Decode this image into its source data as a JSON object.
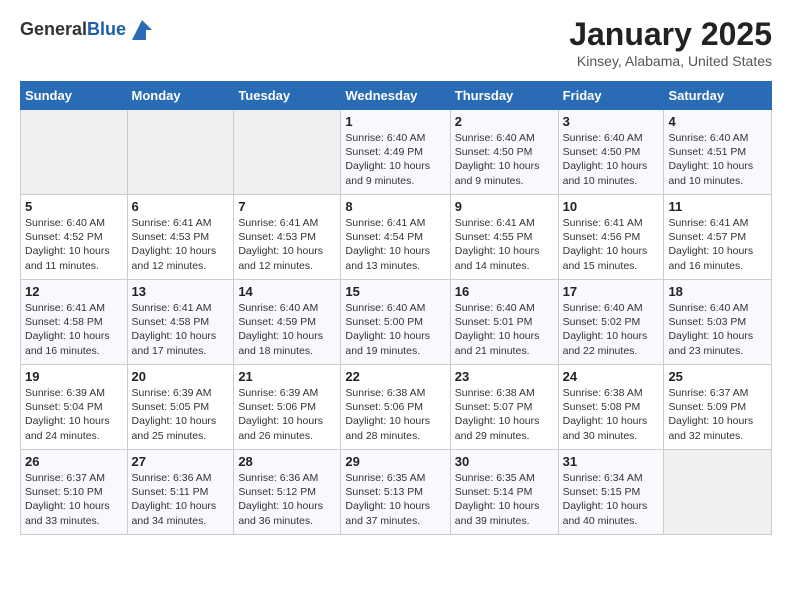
{
  "header": {
    "logo_general": "General",
    "logo_blue": "Blue",
    "month": "January 2025",
    "location": "Kinsey, Alabama, United States"
  },
  "days_of_week": [
    "Sunday",
    "Monday",
    "Tuesday",
    "Wednesday",
    "Thursday",
    "Friday",
    "Saturday"
  ],
  "weeks": [
    [
      {
        "num": "",
        "info": ""
      },
      {
        "num": "",
        "info": ""
      },
      {
        "num": "",
        "info": ""
      },
      {
        "num": "1",
        "info": "Sunrise: 6:40 AM\nSunset: 4:49 PM\nDaylight: 10 hours\nand 9 minutes."
      },
      {
        "num": "2",
        "info": "Sunrise: 6:40 AM\nSunset: 4:50 PM\nDaylight: 10 hours\nand 9 minutes."
      },
      {
        "num": "3",
        "info": "Sunrise: 6:40 AM\nSunset: 4:50 PM\nDaylight: 10 hours\nand 10 minutes."
      },
      {
        "num": "4",
        "info": "Sunrise: 6:40 AM\nSunset: 4:51 PM\nDaylight: 10 hours\nand 10 minutes."
      }
    ],
    [
      {
        "num": "5",
        "info": "Sunrise: 6:40 AM\nSunset: 4:52 PM\nDaylight: 10 hours\nand 11 minutes."
      },
      {
        "num": "6",
        "info": "Sunrise: 6:41 AM\nSunset: 4:53 PM\nDaylight: 10 hours\nand 12 minutes."
      },
      {
        "num": "7",
        "info": "Sunrise: 6:41 AM\nSunset: 4:53 PM\nDaylight: 10 hours\nand 12 minutes."
      },
      {
        "num": "8",
        "info": "Sunrise: 6:41 AM\nSunset: 4:54 PM\nDaylight: 10 hours\nand 13 minutes."
      },
      {
        "num": "9",
        "info": "Sunrise: 6:41 AM\nSunset: 4:55 PM\nDaylight: 10 hours\nand 14 minutes."
      },
      {
        "num": "10",
        "info": "Sunrise: 6:41 AM\nSunset: 4:56 PM\nDaylight: 10 hours\nand 15 minutes."
      },
      {
        "num": "11",
        "info": "Sunrise: 6:41 AM\nSunset: 4:57 PM\nDaylight: 10 hours\nand 16 minutes."
      }
    ],
    [
      {
        "num": "12",
        "info": "Sunrise: 6:41 AM\nSunset: 4:58 PM\nDaylight: 10 hours\nand 16 minutes."
      },
      {
        "num": "13",
        "info": "Sunrise: 6:41 AM\nSunset: 4:58 PM\nDaylight: 10 hours\nand 17 minutes."
      },
      {
        "num": "14",
        "info": "Sunrise: 6:40 AM\nSunset: 4:59 PM\nDaylight: 10 hours\nand 18 minutes."
      },
      {
        "num": "15",
        "info": "Sunrise: 6:40 AM\nSunset: 5:00 PM\nDaylight: 10 hours\nand 19 minutes."
      },
      {
        "num": "16",
        "info": "Sunrise: 6:40 AM\nSunset: 5:01 PM\nDaylight: 10 hours\nand 21 minutes."
      },
      {
        "num": "17",
        "info": "Sunrise: 6:40 AM\nSunset: 5:02 PM\nDaylight: 10 hours\nand 22 minutes."
      },
      {
        "num": "18",
        "info": "Sunrise: 6:40 AM\nSunset: 5:03 PM\nDaylight: 10 hours\nand 23 minutes."
      }
    ],
    [
      {
        "num": "19",
        "info": "Sunrise: 6:39 AM\nSunset: 5:04 PM\nDaylight: 10 hours\nand 24 minutes."
      },
      {
        "num": "20",
        "info": "Sunrise: 6:39 AM\nSunset: 5:05 PM\nDaylight: 10 hours\nand 25 minutes."
      },
      {
        "num": "21",
        "info": "Sunrise: 6:39 AM\nSunset: 5:06 PM\nDaylight: 10 hours\nand 26 minutes."
      },
      {
        "num": "22",
        "info": "Sunrise: 6:38 AM\nSunset: 5:06 PM\nDaylight: 10 hours\nand 28 minutes."
      },
      {
        "num": "23",
        "info": "Sunrise: 6:38 AM\nSunset: 5:07 PM\nDaylight: 10 hours\nand 29 minutes."
      },
      {
        "num": "24",
        "info": "Sunrise: 6:38 AM\nSunset: 5:08 PM\nDaylight: 10 hours\nand 30 minutes."
      },
      {
        "num": "25",
        "info": "Sunrise: 6:37 AM\nSunset: 5:09 PM\nDaylight: 10 hours\nand 32 minutes."
      }
    ],
    [
      {
        "num": "26",
        "info": "Sunrise: 6:37 AM\nSunset: 5:10 PM\nDaylight: 10 hours\nand 33 minutes."
      },
      {
        "num": "27",
        "info": "Sunrise: 6:36 AM\nSunset: 5:11 PM\nDaylight: 10 hours\nand 34 minutes."
      },
      {
        "num": "28",
        "info": "Sunrise: 6:36 AM\nSunset: 5:12 PM\nDaylight: 10 hours\nand 36 minutes."
      },
      {
        "num": "29",
        "info": "Sunrise: 6:35 AM\nSunset: 5:13 PM\nDaylight: 10 hours\nand 37 minutes."
      },
      {
        "num": "30",
        "info": "Sunrise: 6:35 AM\nSunset: 5:14 PM\nDaylight: 10 hours\nand 39 minutes."
      },
      {
        "num": "31",
        "info": "Sunrise: 6:34 AM\nSunset: 5:15 PM\nDaylight: 10 hours\nand 40 minutes."
      },
      {
        "num": "",
        "info": ""
      }
    ]
  ]
}
